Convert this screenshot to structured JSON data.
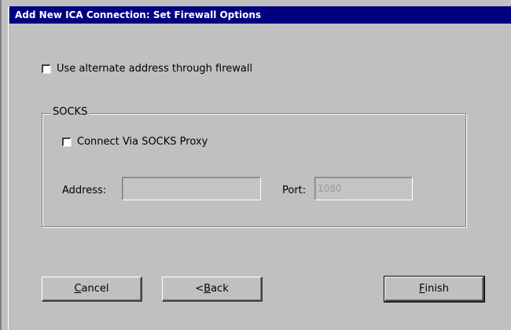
{
  "window": {
    "title": "Add New ICA Connection: Set Firewall Options"
  },
  "options": {
    "alternate_address_label": "Use alternate address through firewall",
    "alternate_address_checked": false
  },
  "socks": {
    "group_label": "SOCKS",
    "connect_label": "Connect Via SOCKS Proxy",
    "connect_checked": false,
    "address_label": "Address:",
    "address_value": "",
    "port_label": "Port:",
    "port_value": "1080"
  },
  "buttons": {
    "cancel": {
      "mnemonic": "C",
      "rest": "ancel"
    },
    "back": {
      "prefix": "<",
      "mnemonic": "B",
      "rest": "ack"
    },
    "finish": {
      "mnemonic": "F",
      "rest": "inish"
    }
  },
  "colors": {
    "titlebar_bg": "#000080",
    "titlebar_fg": "#ffffff",
    "face": "#c0c0c0"
  }
}
